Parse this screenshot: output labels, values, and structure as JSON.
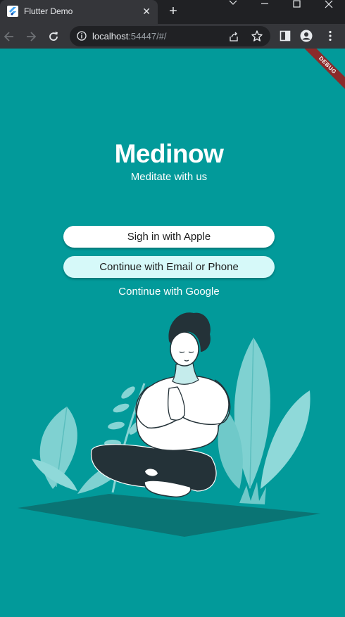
{
  "browser": {
    "tab_title": "Flutter Demo",
    "url_host": "localhost",
    "url_rest": ":54447/#/"
  },
  "app": {
    "debug_label": "DEBUG",
    "title": "Medinow",
    "subtitle": "Meditate with us",
    "apple_button": "Sigh in with Apple",
    "email_button": "Continue with Email or Phone",
    "google_link": "Continue with Google"
  },
  "colors": {
    "background": "#029a9a",
    "email_button": "#d6f9f9",
    "debug_banner": "#8b2a2a"
  },
  "icons": [
    "flutter-icon",
    "close-icon",
    "plus-icon",
    "back-icon",
    "forward-icon",
    "reload-icon",
    "info-icon",
    "share-icon",
    "star-icon",
    "sidebar-icon",
    "profile-icon",
    "menu-icon"
  ]
}
